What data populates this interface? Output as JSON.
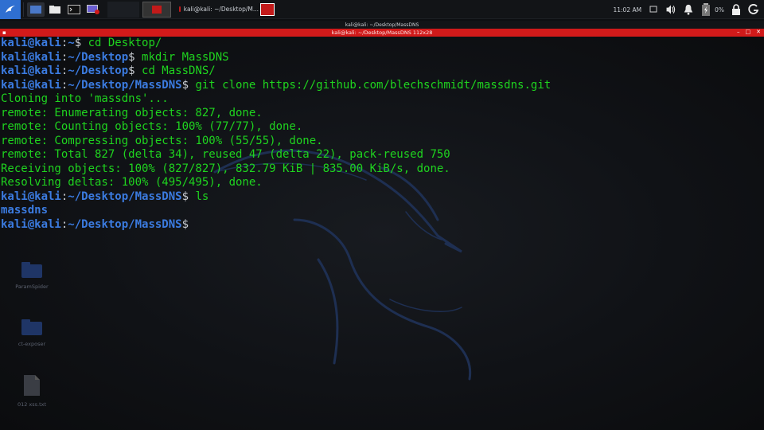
{
  "panel": {
    "clock": "11:02 AM",
    "battery": "0%",
    "task_title": "kali@kali: ~/Desktop/M...",
    "icons": [
      "kali-menu-icon",
      "workspace-icon",
      "folder-icon",
      "terminal-icon",
      "recorder-icon",
      "display-icon",
      "volume-icon",
      "bell-icon",
      "battery-icon",
      "lock-icon",
      "logout-icon"
    ]
  },
  "window": {
    "title": "kali@kali: ~/Desktop/MassDNS",
    "tab_title": "kali@kali: ~/Desktop/MassDNS 112x28"
  },
  "prompt": {
    "user_host": "kali@kali",
    "sep": ":"
  },
  "terminal": [
    {
      "path": "~",
      "cmd": "cd Desktop/"
    },
    {
      "path": "~/Desktop",
      "cmd": "mkdir MassDNS"
    },
    {
      "path": "~/Desktop",
      "cmd": "cd MassDNS/"
    },
    {
      "path": "~/Desktop/MassDNS",
      "cmd": "git clone https://github.com/blechschmidt/massdns.git"
    },
    {
      "out": "Cloning into 'massdns'..."
    },
    {
      "out": "remote: Enumerating objects: 827, done."
    },
    {
      "out": "remote: Counting objects: 100% (77/77), done."
    },
    {
      "out": "remote: Compressing objects: 100% (55/55), done."
    },
    {
      "out": "remote: Total 827 (delta 34), reused 47 (delta 22), pack-reused 750"
    },
    {
      "out": "Receiving objects: 100% (827/827), 832.79 KiB | 835.00 KiB/s, done."
    },
    {
      "out": "Resolving deltas: 100% (495/495), done."
    },
    {
      "path": "~/Desktop/MassDNS",
      "cmd": "ls"
    },
    {
      "dir": "massdns"
    },
    {
      "path": "~/Desktop/MassDNS",
      "cmd": ""
    }
  ],
  "desktop_icons": [
    {
      "label": "ParamSpider"
    },
    {
      "label": "ct-exposer"
    },
    {
      "label": "012 xss.txt"
    }
  ]
}
